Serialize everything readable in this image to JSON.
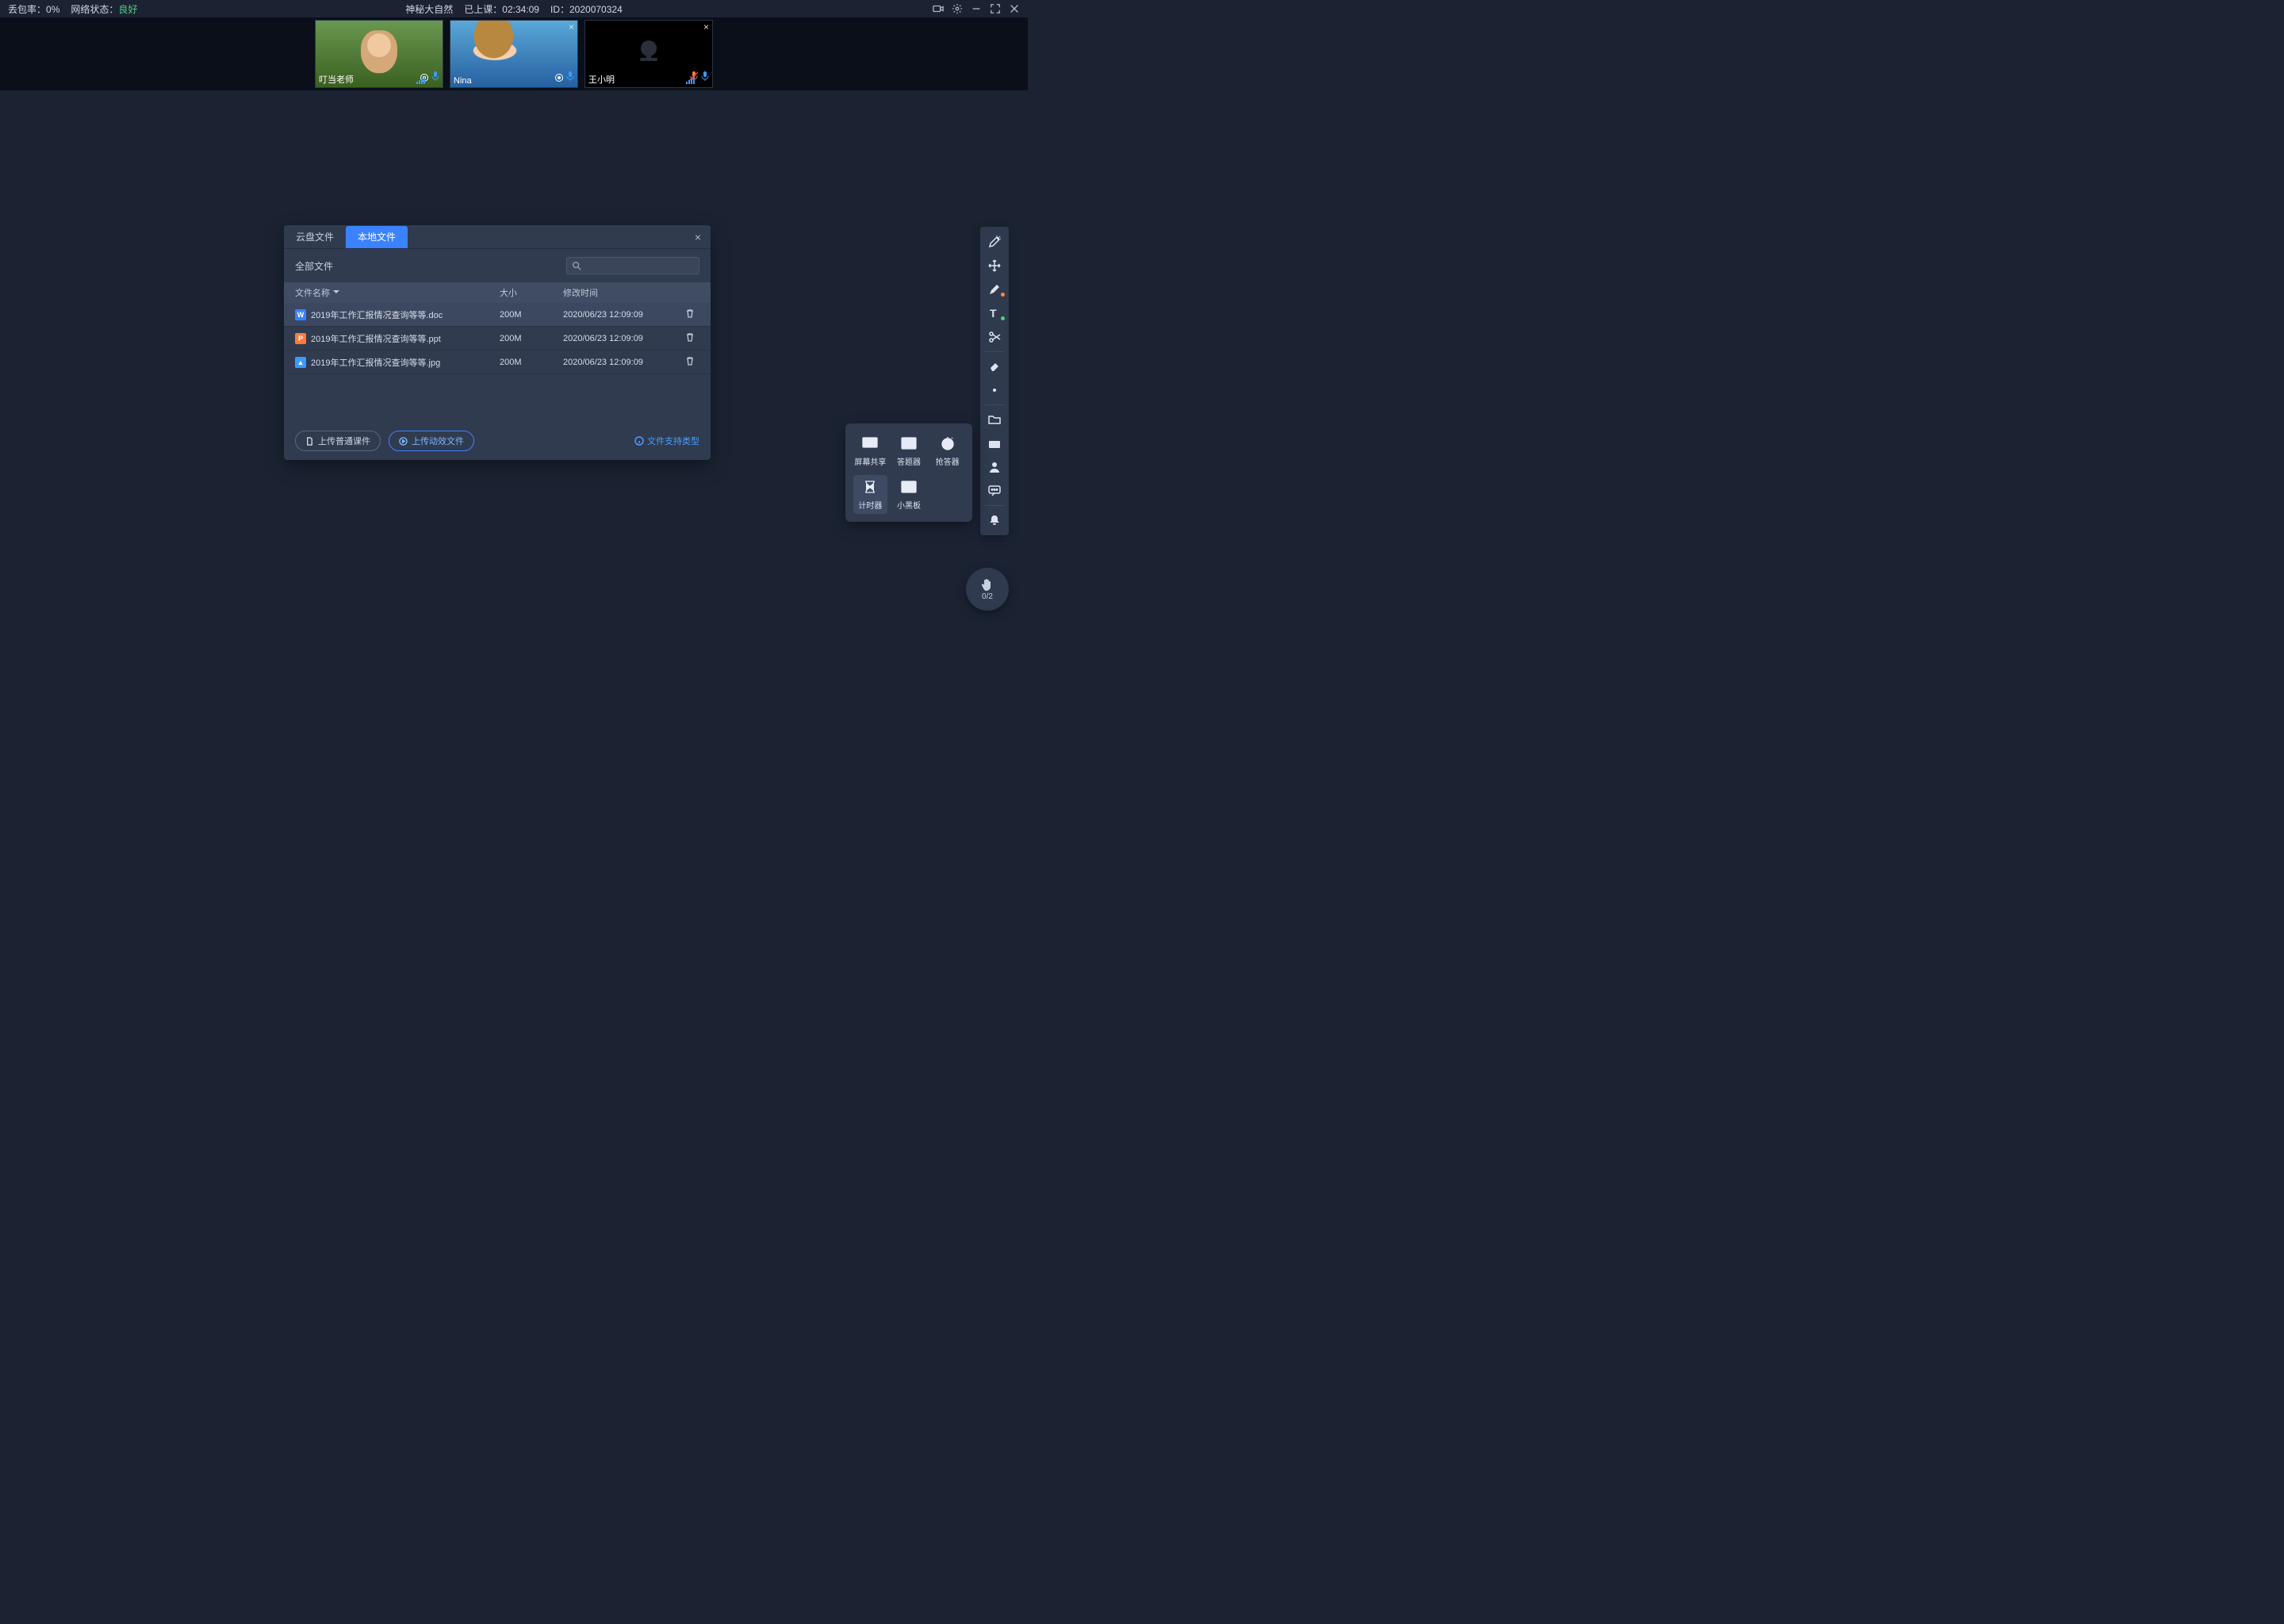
{
  "topbar": {
    "loss_label": "丢包率：",
    "loss_value": "0%",
    "net_label": "网络状态：",
    "net_value": "良好",
    "title": "神秘大自然",
    "elapsed_label": "已上课：",
    "elapsed_value": "02:34:09",
    "id_label": "ID：",
    "id_value": "2020070324"
  },
  "participants": [
    {
      "name": "叮当老师",
      "cam": "on",
      "closable": false,
      "muted": false
    },
    {
      "name": "Nina",
      "cam": "on",
      "closable": true,
      "muted": false
    },
    {
      "name": "王小明",
      "cam": "off",
      "closable": true,
      "muted": true
    }
  ],
  "dialog": {
    "tabs": {
      "cloud": "云盘文件",
      "local": "本地文件"
    },
    "filter_label": "全部文件",
    "columns": {
      "name": "文件名称",
      "size": "大小",
      "mtime": "修改时间"
    },
    "rows": [
      {
        "kind": "w",
        "letter": "W",
        "name": "2019年工作汇报情况查询等等.doc",
        "size": "200M",
        "mtime": "2020/06/23 12:09:09"
      },
      {
        "kind": "p",
        "letter": "P",
        "name": "2019年工作汇报情况查询等等.ppt",
        "size": "200M",
        "mtime": "2020/06/23 12:09:09"
      },
      {
        "kind": "i",
        "letter": "▲",
        "name": "2019年工作汇报情况查询等等.jpg",
        "size": "200M",
        "mtime": "2020/06/23 12:09:09"
      }
    ],
    "upload_normal": "上传普通课件",
    "upload_dynamic": "上传动效文件",
    "supported_hint": "文件支持类型"
  },
  "tools_popup": {
    "screen_share": "屏幕共享",
    "answer": "答题器",
    "responder": "抢答器",
    "timer": "计时器",
    "blackboard": "小黑板"
  },
  "hand": {
    "count": "0/2"
  }
}
